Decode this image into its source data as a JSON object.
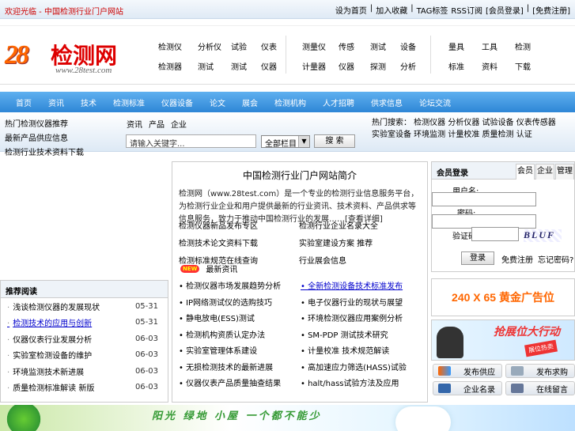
{
  "topbar": {
    "welcome": "欢迎光临 - 中国检测行业门户网站",
    "links": [
      "设为首页",
      "|",
      "加入收藏",
      "|",
      "TAG标签",
      "RSS订阅",
      "[会员登录]",
      "|",
      "[免费注册]"
    ]
  },
  "logo": {
    "num": "28",
    "cn": "检测网",
    "url": "www.28test.com"
  },
  "categories": {
    "group1": [
      "检测仪",
      "分析仪",
      "试验",
      "仪表",
      "检测器",
      "测试",
      "测试",
      "仪器"
    ],
    "group2": [
      "测量仪",
      "传感",
      "测试",
      "设备",
      "计量器",
      "仪器",
      "探测",
      "分析"
    ],
    "group3": [
      "量具",
      "工具",
      "检测",
      "标准",
      "资料",
      "下载"
    ]
  },
  "nav": [
    "首页",
    "资讯",
    "技术",
    "检测标准",
    "仪器设备",
    "论文",
    "展会",
    "检测机构",
    "人才招聘",
    "供求信息",
    "论坛交流"
  ],
  "infobar": {
    "hot": [
      "热门检测仪器推荐",
      "最新产品供应信息",
      "检测行业技术资料下载"
    ],
    "search_tabs": [
      "资讯",
      "产品",
      "企业"
    ],
    "search_placeholder": "请输入关键字...",
    "search_select": "全部栏目",
    "search_button": "搜 索",
    "hotwords": "热门搜索： 检测仪器 分析仪器 试验设备 仪表传感器 实验室设备 环境监测 计量校准 质量检测 认证"
  },
  "left": {
    "title": "推荐阅读",
    "items": [
      {
        "text": "浅谈检测仪器的发展现状",
        "date": "05-31",
        "link": false
      },
      {
        "text": "检测技术的应用与创新",
        "date": "05-31",
        "link": true
      },
      {
        "text": "仪器仪表行业发展分析",
        "date": "06-03",
        "link": false
      },
      {
        "text": "实验室检测设备的维护",
        "date": "06-03",
        "link": false
      },
      {
        "text": "环境监测技术新进展",
        "date": "06-03",
        "link": false
      },
      {
        "text": "质量检测标准解读 新版",
        "date": "06-03",
        "link": false
      }
    ]
  },
  "center": {
    "title": "中国检测行业门户网站简介",
    "intro": "检测网（www.28test.com）是一个专业的检测行业信息服务平台，为检测行业企业和用户提供最新的行业资讯、技术资料、产品供求等信息服务，致力于推动中国检测行业的发展……[查看详细]",
    "links": [
      "检测仪器新品发布专区",
      "检测行业企业名录大全",
      "检测技术论文资料下载",
      "实验室建设方案 推荐",
      "检测标准规范在线查询",
      "行业展会信息"
    ],
    "news_label": "最新资讯",
    "new_badge": "NEW",
    "news": [
      {
        "text": "• 检测仪器市场发展趋势分析",
        "link": false
      },
      {
        "text": "• 全新检测设备技术标准发布",
        "link": true
      },
      {
        "text": "• IP网络测试仪的选购技巧",
        "link": false
      },
      {
        "text": "• 电子仪器行业的现状与展望",
        "link": false
      },
      {
        "text": "• 静电放电(ESS)测试",
        "link": false
      },
      {
        "text": "• 环境检测仪器应用案例分析",
        "link": false
      },
      {
        "text": "• 检测机构资质认定办法",
        "link": false
      },
      {
        "text": "• SM-PDP 测试技术研究",
        "link": false
      },
      {
        "text": "• 实验室管理体系建设",
        "link": false
      },
      {
        "text": "• 计量校准 技术规范解读",
        "link": false
      },
      {
        "text": "• 无损检测技术的最新进展",
        "link": false
      },
      {
        "text": "• 高加速应力筛选(HASS)试验",
        "link": false
      },
      {
        "text": "• 仪器仪表产品质量抽查结果",
        "link": false
      },
      {
        "text": "• halt/hass试验方法及应用",
        "link": false
      }
    ]
  },
  "login": {
    "title": "会员登录",
    "tabs": [
      "会员",
      "企业",
      "管理"
    ],
    "user_label": "用户名:",
    "pass_label": "密码:",
    "code_label": "验证码:",
    "captcha": "BLUF",
    "button": "登录",
    "register": "免费注册",
    "forgot": "忘记密码?"
  },
  "ads": {
    "ad1": "240 X 65 黄金广告位",
    "ad2_title": "抢展位大行动",
    "ad2_badge": "展位热卖"
  },
  "icon_buttons": [
    "发布供应",
    "发布求购",
    "企业名录",
    "在线留言"
  ],
  "banner": {
    "slogan": "阳光 绿地 小屋 一个都不能少"
  }
}
